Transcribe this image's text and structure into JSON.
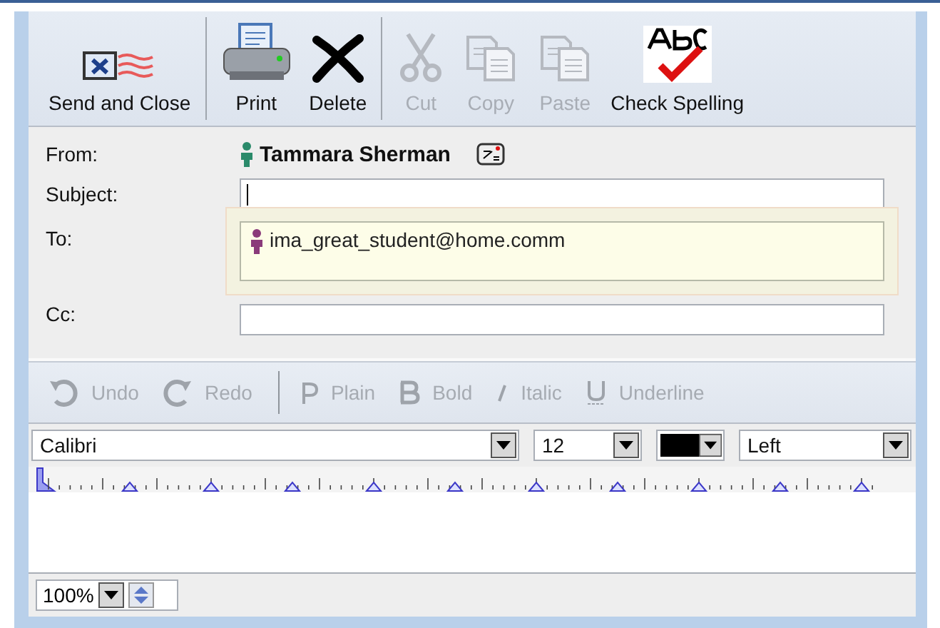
{
  "toolbar": [
    {
      "kind": "send",
      "label": "Send and Close",
      "disabled": false,
      "separator_after": true
    },
    {
      "kind": "print",
      "label": "Print",
      "disabled": false,
      "separator_after": false
    },
    {
      "kind": "delete",
      "label": "Delete",
      "disabled": false,
      "separator_after": true
    },
    {
      "kind": "cut",
      "label": "Cut",
      "disabled": true,
      "separator_after": false
    },
    {
      "kind": "copy",
      "label": "Copy",
      "disabled": true,
      "separator_after": false
    },
    {
      "kind": "paste",
      "label": "Paste",
      "disabled": true,
      "separator_after": false
    },
    {
      "kind": "spell",
      "label": "Check Spelling",
      "disabled": false,
      "separator_after": false
    }
  ],
  "header": {
    "from_label": "From:",
    "from_name": "Tammara Sherman",
    "subject_label": "Subject:",
    "to_label": "To:",
    "to_recipient": "ima_great_student@home.comm",
    "cc_label": "Cc:"
  },
  "format_toolbar": [
    {
      "kind": "undo",
      "label": "Undo",
      "disabled": true,
      "separator_after": false
    },
    {
      "kind": "redo",
      "label": "Redo",
      "disabled": true,
      "separator_after": true
    },
    {
      "kind": "plain",
      "label": "Plain",
      "disabled": true,
      "separator_after": false
    },
    {
      "kind": "bold",
      "label": "Bold",
      "disabled": true,
      "separator_after": false
    },
    {
      "kind": "italic",
      "label": "Italic",
      "disabled": true,
      "separator_after": false
    },
    {
      "kind": "underline",
      "label": "Underline",
      "disabled": true,
      "separator_after": false
    }
  ],
  "font_bar": {
    "font": "Calibri",
    "size": "12",
    "color": "#000000",
    "alignment": "Left"
  },
  "zoom": "100%"
}
